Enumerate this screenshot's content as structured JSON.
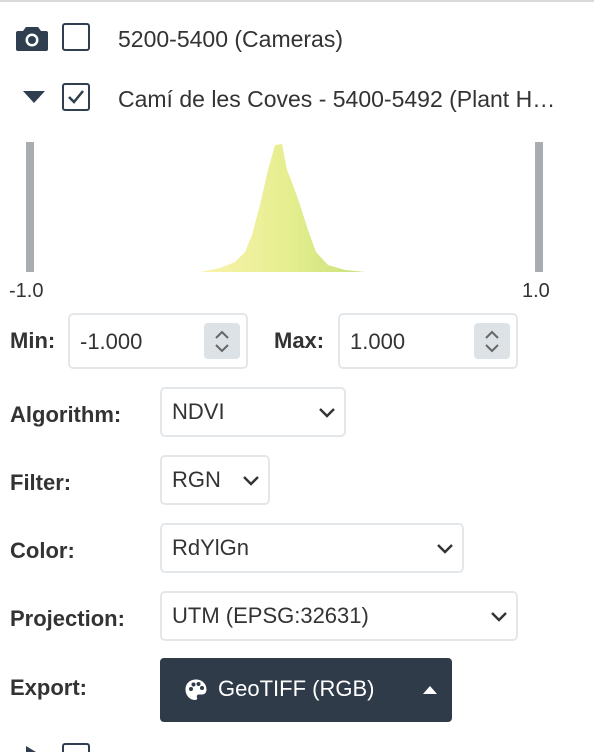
{
  "layers": [
    {
      "label": "5200-5400 (Cameras)",
      "checked": false,
      "icon": "camera-icon"
    },
    {
      "label": "Camí de les Coves - 5400-5492 (Plant H…",
      "checked": true,
      "icon": "chevron-down-icon"
    }
  ],
  "histogram": {
    "min_label": "-1.0",
    "max_label": "1.0",
    "gradient_colors": [
      "#fbf3ad",
      "#e4ee8e",
      "#c7e07a"
    ]
  },
  "min": {
    "label": "Min:",
    "value": "-1.000"
  },
  "max": {
    "label": "Max:",
    "value": "1.000"
  },
  "algorithm": {
    "label": "Algorithm:",
    "value": "NDVI"
  },
  "filter": {
    "label": "Filter:",
    "value": "RGN"
  },
  "color": {
    "label": "Color:",
    "value": "RdYlGn"
  },
  "projection": {
    "label": "Projection:",
    "value": "UTM (EPSG:32631)"
  },
  "export": {
    "label": "Export:",
    "button_label": "GeoTIFF (RGB)",
    "button_color": "#2f3b49",
    "icon": "palette-icon"
  }
}
